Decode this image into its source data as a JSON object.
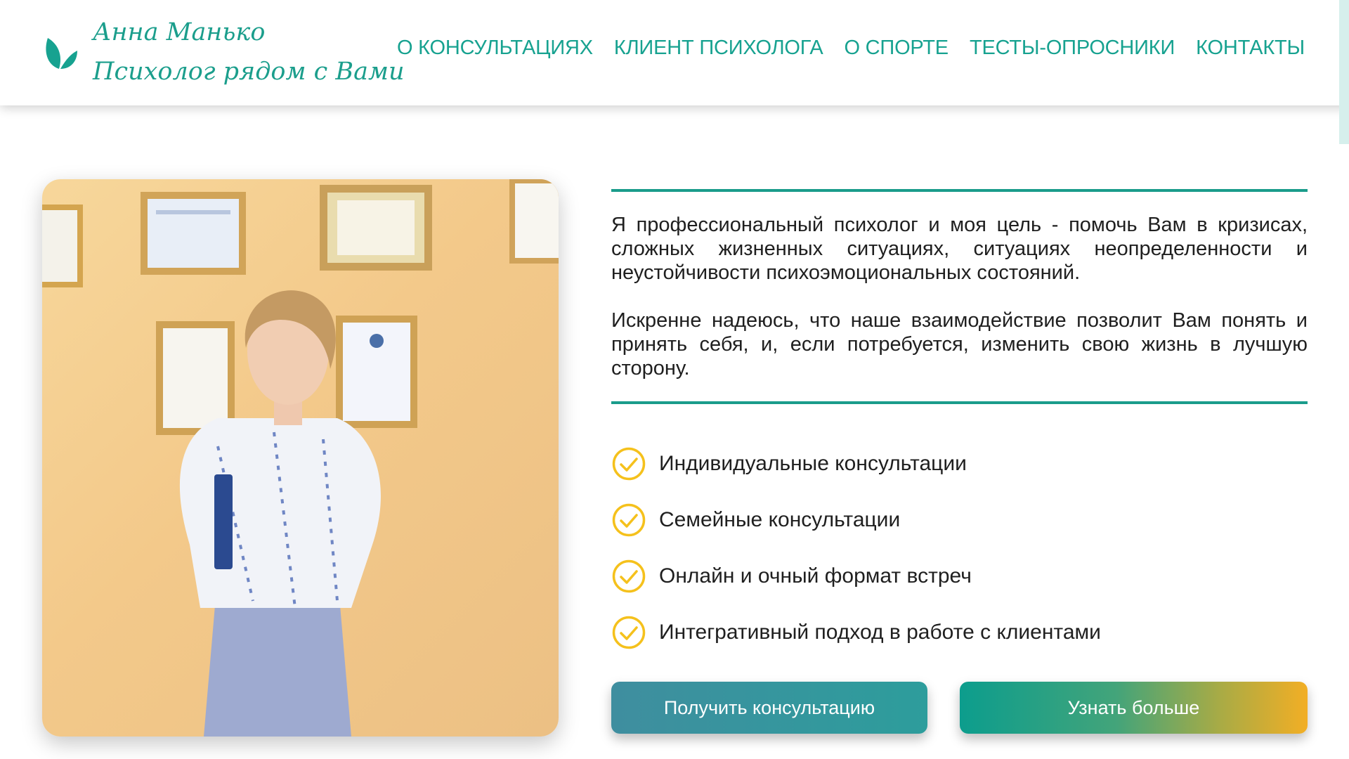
{
  "colors": {
    "brand_teal": "#17a290",
    "check_yellow": "#f5c11c",
    "rule": "#1a9c8b"
  },
  "header": {
    "logo": {
      "icon": "leaf-icon",
      "name": "Анна Манько",
      "tagline": "Психолог рядом с Вами"
    },
    "nav": [
      {
        "label": "О КОНСУЛЬТАЦИЯХ"
      },
      {
        "label": "КЛИЕНТ ПСИХОЛОГА"
      },
      {
        "label": "О СПОРТЕ"
      },
      {
        "label": "ТЕСТЫ-ОПРОСНИКИ"
      },
      {
        "label": "КОНТАКТЫ"
      }
    ]
  },
  "hero": {
    "photo": {
      "icon": "portrait-photo"
    },
    "paragraphs": [
      "Я профессиональный психолог и моя цель - помочь Вам в кризисах, сложных жизненных ситуациях, ситуациях неопределенности и неустойчивости психоэмоциональных состояний.",
      "Искренне надеюсь, что наше взаимодействие позволит Вам понять и принять себя, и, если потребуется, изменить свою жизнь в лучшую сторону."
    ],
    "features": [
      {
        "icon": "check-circle-icon",
        "text": "Индивидуальные консультации"
      },
      {
        "icon": "check-circle-icon",
        "text": "Семейные консультации"
      },
      {
        "icon": "check-circle-icon",
        "text": "Онлайн и очный формат встреч"
      },
      {
        "icon": "check-circle-icon",
        "text": "Интегративный подход в работе с клиентами"
      }
    ],
    "buttons": {
      "primary": "Получить консультацию",
      "secondary": "Узнать больше"
    }
  }
}
